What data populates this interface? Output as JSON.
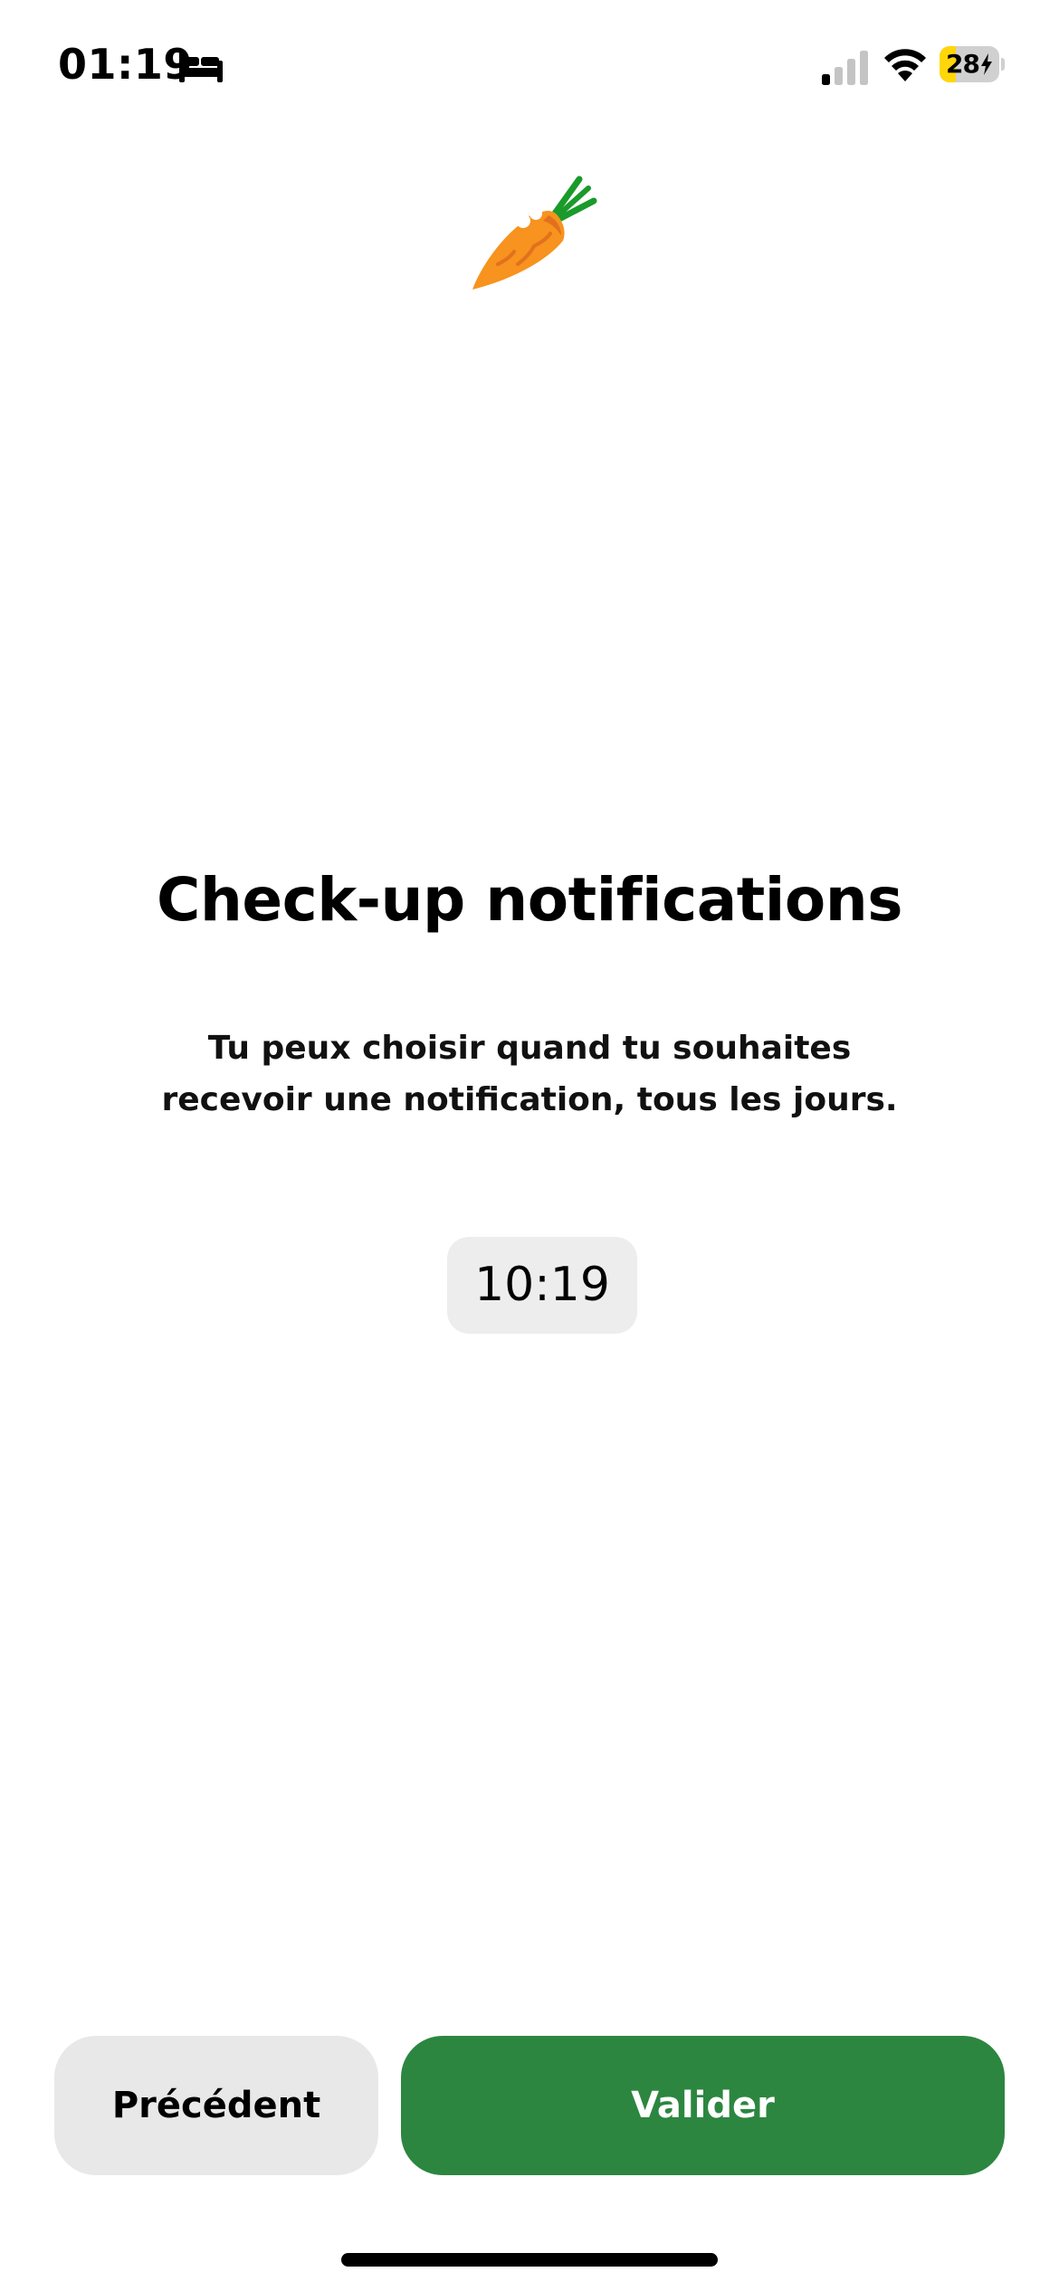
{
  "status_bar": {
    "time": "01:19",
    "battery_percent": "28",
    "battery_level": 0.28,
    "battery_color": "#ffd60a",
    "icons": [
      "bed-icon",
      "signal-icon",
      "wifi-icon",
      "battery-icon",
      "charging-bolt-icon"
    ]
  },
  "header": {
    "logo_icon": "carrot-icon"
  },
  "main": {
    "title": "Check-up notifications",
    "description": "Tu peux choisir quand tu souhaites recevoir une notification, tous les jours.",
    "time_picker_value": "10:19"
  },
  "footer": {
    "previous_label": "Précédent",
    "validate_label": "Valider",
    "accent_color": "#2c8640"
  }
}
